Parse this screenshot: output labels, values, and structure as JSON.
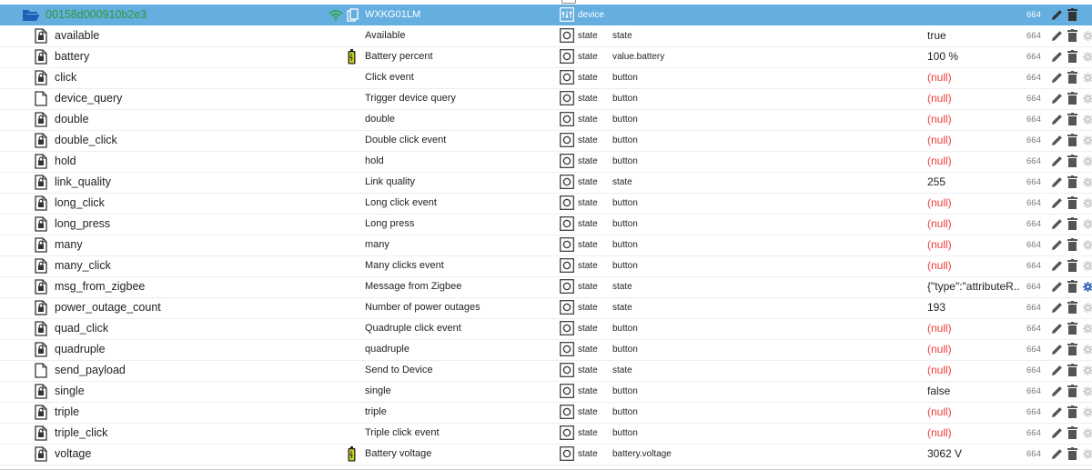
{
  "header": {
    "id": "00158d000910b2e3",
    "name": "WXKG01LM",
    "type": "device",
    "acl": "664",
    "icons": [
      "folder-open-icon",
      "wifi-icon",
      "copy-icon",
      "device-icon",
      "pencil-icon",
      "trash-icon"
    ],
    "colors": {
      "bg": "#64aee0",
      "id": "#2f9a34"
    }
  },
  "rows": [
    {
      "id": "available",
      "name": "Available",
      "type": "state",
      "role": "state",
      "value": "true",
      "acl": "664",
      "null": false,
      "icon": "state-file-icon"
    },
    {
      "id": "battery",
      "name": "Battery percent",
      "type": "state",
      "role": "value.battery",
      "value": "100 %",
      "acl": "664",
      "null": false,
      "icon": "state-file-icon",
      "battery": true
    },
    {
      "id": "click",
      "name": "Click event",
      "type": "state",
      "role": "button",
      "value": "(null)",
      "acl": "664",
      "null": true,
      "icon": "state-file-icon"
    },
    {
      "id": "device_query",
      "name": "Trigger device query",
      "type": "state",
      "role": "button",
      "value": "(null)",
      "acl": "664",
      "null": true,
      "icon": "plain-file-icon"
    },
    {
      "id": "double",
      "name": "double",
      "type": "state",
      "role": "button",
      "value": "(null)",
      "acl": "664",
      "null": true,
      "icon": "state-file-icon"
    },
    {
      "id": "double_click",
      "name": "Double click event",
      "type": "state",
      "role": "button",
      "value": "(null)",
      "acl": "664",
      "null": true,
      "icon": "state-file-icon"
    },
    {
      "id": "hold",
      "name": "hold",
      "type": "state",
      "role": "button",
      "value": "(null)",
      "acl": "664",
      "null": true,
      "icon": "state-file-icon"
    },
    {
      "id": "link_quality",
      "name": "Link quality",
      "type": "state",
      "role": "state",
      "value": "255",
      "acl": "664",
      "null": false,
      "icon": "state-file-icon"
    },
    {
      "id": "long_click",
      "name": "Long click event",
      "type": "state",
      "role": "button",
      "value": "(null)",
      "acl": "664",
      "null": true,
      "icon": "state-file-icon"
    },
    {
      "id": "long_press",
      "name": "Long press",
      "type": "state",
      "role": "button",
      "value": "(null)",
      "acl": "664",
      "null": true,
      "icon": "state-file-icon"
    },
    {
      "id": "many",
      "name": "many",
      "type": "state",
      "role": "button",
      "value": "(null)",
      "acl": "664",
      "null": true,
      "icon": "state-file-icon"
    },
    {
      "id": "many_click",
      "name": "Many clicks event",
      "type": "state",
      "role": "button",
      "value": "(null)",
      "acl": "664",
      "null": true,
      "icon": "state-file-icon"
    },
    {
      "id": "msg_from_zigbee",
      "name": "Message from Zigbee",
      "type": "state",
      "role": "state",
      "value": "{\"type\":\"attributeR...",
      "acl": "664",
      "null": false,
      "icon": "state-file-icon",
      "gear_active": true
    },
    {
      "id": "power_outage_count",
      "name": "Number of power outages",
      "type": "state",
      "role": "state",
      "value": "193",
      "acl": "664",
      "null": false,
      "icon": "state-file-icon"
    },
    {
      "id": "quad_click",
      "name": "Quadruple click event",
      "type": "state",
      "role": "button",
      "value": "(null)",
      "acl": "664",
      "null": true,
      "icon": "state-file-icon"
    },
    {
      "id": "quadruple",
      "name": "quadruple",
      "type": "state",
      "role": "button",
      "value": "(null)",
      "acl": "664",
      "null": true,
      "icon": "state-file-icon"
    },
    {
      "id": "send_payload",
      "name": "Send to Device",
      "type": "state",
      "role": "state",
      "value": "(null)",
      "acl": "664",
      "null": true,
      "icon": "plain-file-icon"
    },
    {
      "id": "single",
      "name": "single",
      "type": "state",
      "role": "button",
      "value": "false",
      "acl": "664",
      "null": false,
      "icon": "state-file-icon"
    },
    {
      "id": "triple",
      "name": "triple",
      "type": "state",
      "role": "button",
      "value": "(null)",
      "acl": "664",
      "null": true,
      "icon": "state-file-icon"
    },
    {
      "id": "triple_click",
      "name": "Triple click event",
      "type": "state",
      "role": "button",
      "value": "(null)",
      "acl": "664",
      "null": true,
      "icon": "state-file-icon"
    },
    {
      "id": "voltage",
      "name": "Battery voltage",
      "type": "state",
      "role": "battery.voltage",
      "value": "3062 V",
      "acl": "664",
      "null": false,
      "icon": "state-file-icon",
      "battery": true
    }
  ]
}
